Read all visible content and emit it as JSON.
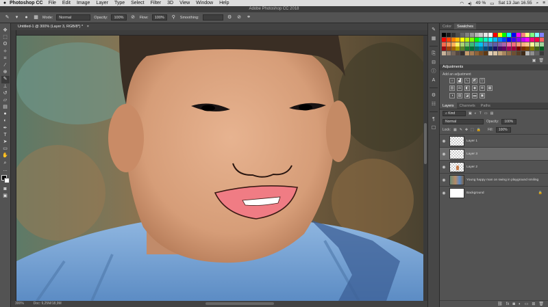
{
  "menubar": {
    "apple": "",
    "app_name": "Photoshop CC",
    "items": [
      "File",
      "Edit",
      "Image",
      "Layer",
      "Type",
      "Select",
      "Filter",
      "3D",
      "View",
      "Window",
      "Help"
    ],
    "battery": "49 %",
    "clock": "Sat 13 Jan 16.55"
  },
  "window_title": "Adobe Photoshop CC 2018",
  "options": {
    "mode_label": "Mode:",
    "mode_value": "Normal",
    "opacity_label": "Opacity:",
    "opacity_value": "100%",
    "flow_label": "Flow:",
    "flow_value": "100%",
    "smoothing_label": "Smoothing:"
  },
  "document": {
    "tab_title": "Untitled-1 @ 300% (Layer 3, RGB/8*) *",
    "zoom": "300%",
    "doc_size": "Doc: 9,25M/18,9M"
  },
  "panels": {
    "color_tab": "Color",
    "swatches_tab": "Swatches",
    "adjustments_title": "Adjustments",
    "adjustments_label": "Add an adjustment",
    "layers_tab": "Layers",
    "channels_tab": "Channels",
    "paths_tab": "Paths",
    "kind_value": "Kind",
    "blend_value": "Normal",
    "opacity_label": "Opacity:",
    "opacity_value": "100%",
    "lock_label": "Lock:",
    "fill_label": "Fill:",
    "fill_value": "100%"
  },
  "layers": [
    {
      "name": "Layer 1",
      "visible": true,
      "selected": false,
      "thumb": "transparent"
    },
    {
      "name": "Layer 3",
      "visible": true,
      "selected": true,
      "thumb": "transparent"
    },
    {
      "name": "Layer 2",
      "visible": true,
      "selected": false,
      "thumb": "figure"
    },
    {
      "name": "Young happy man on swing in playground smiling",
      "visible": true,
      "selected": false,
      "thumb": "photo"
    },
    {
      "name": "Background",
      "visible": true,
      "selected": false,
      "thumb": "white",
      "locked": true
    }
  ],
  "swatch_colors": [
    "#000000",
    "#1a1a1a",
    "#333333",
    "#4d4d4d",
    "#666666",
    "#808080",
    "#999999",
    "#b3b3b3",
    "#cccccc",
    "#e6e6e6",
    "#ffffff",
    "#ff0000",
    "#ffff00",
    "#00ff00",
    "#00ffff",
    "#0000ff",
    "#ff00ff",
    "#ff8080",
    "#ffff80",
    "#80ff80",
    "#80ffff",
    "#8080ff",
    "#ff0000",
    "#ff4000",
    "#ff8000",
    "#ffbf00",
    "#ffff00",
    "#bfff00",
    "#80ff00",
    "#00ff00",
    "#00ff80",
    "#00ffbf",
    "#00ffff",
    "#00bfff",
    "#0080ff",
    "#0040ff",
    "#0000ff",
    "#4000ff",
    "#8000ff",
    "#bf00ff",
    "#ff00ff",
    "#ff0080",
    "#ff0040",
    "#ff6060",
    "#f26c4f",
    "#f68e55",
    "#fbaf5c",
    "#fff467",
    "#acd372",
    "#7cc576",
    "#3bb878",
    "#1abbb4",
    "#00bff3",
    "#438ccb",
    "#5574b9",
    "#605ca8",
    "#855fa8",
    "#a763a8",
    "#f06ea9",
    "#f26d7d",
    "#f7977a",
    "#f9ad81",
    "#fdc68a",
    "#fff79a",
    "#c4df9b",
    "#a3d39c",
    "#9e0b0f",
    "#a0410d",
    "#a36209",
    "#aba000",
    "#598527",
    "#1a7b30",
    "#007236",
    "#00746b",
    "#0076a3",
    "#004b80",
    "#003471",
    "#1b1464",
    "#440e62",
    "#630460",
    "#9e005d",
    "#9e0039",
    "#790000",
    "#7b2e00",
    "#7d4900",
    "#827b00",
    "#406618",
    "#005e20",
    "#c7b299",
    "#998675",
    "#736357",
    "#534741",
    "#37302d",
    "#c69c6d",
    "#a67c52",
    "#8c6239",
    "#754c24",
    "#603913",
    "#e2cfb6",
    "#d9c3a3",
    "#c4a57a",
    "#a6855e",
    "#8f6b45",
    "#6e4f31",
    "#5a3f25",
    "#3e2a17",
    "#b8b8b8",
    "#8f8f8f",
    "#636363",
    "#3a3a3a"
  ]
}
